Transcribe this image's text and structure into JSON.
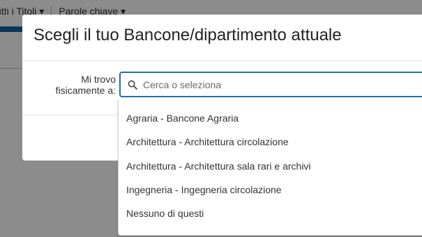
{
  "background": {
    "tabs": [
      "utti i Titoli ▾",
      "Parole chiave ▾"
    ]
  },
  "modal": {
    "title": "Scegli il tuo Bancone/dipartimento attuale",
    "field_label_line1": "Mi trovo",
    "field_label_line2": "fisicamente a:",
    "search": {
      "placeholder": "Cerca o seleziona",
      "value": ""
    },
    "options": [
      "Agraria - Bancone Agraria",
      "Architettura - Architettura circolazione",
      "Architettura - Architettura sala rari e archivi",
      "Ingegneria - Ingegneria circolazione",
      "Nessuno di questi"
    ]
  },
  "colors": {
    "accent": "#1f6fb3",
    "brand_bar": "#1565a7",
    "overlay": "rgba(0,0,0,0.45)"
  },
  "icons": {
    "search": "search-icon"
  }
}
